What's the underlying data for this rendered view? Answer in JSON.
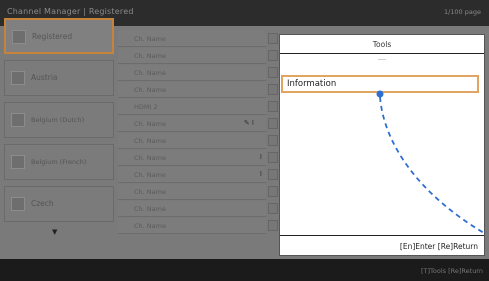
{
  "header": {
    "title": "Channel Manager | Registered",
    "page_indicator": "1/100 page"
  },
  "countries": [
    {
      "label": "Registered",
      "selected": true
    },
    {
      "label": "Austria"
    },
    {
      "label": "Belgium (Dutch)"
    },
    {
      "label": "Belgium (French)"
    },
    {
      "label": "Czech"
    }
  ],
  "scroll_down_glyph": "▼",
  "channels": [
    {
      "label": "Ch. Name"
    },
    {
      "label": "Ch. Name"
    },
    {
      "label": "Ch. Name"
    },
    {
      "label": "Ch. Name"
    },
    {
      "label": "HDMI 2"
    },
    {
      "label": "Ch. Name",
      "icons": "✎ I"
    },
    {
      "label": "Ch. Name"
    },
    {
      "label": "Ch. Name",
      "icons": "I"
    },
    {
      "label": "Ch. Name",
      "icons": "I"
    },
    {
      "label": "Ch. Name"
    },
    {
      "label": "Ch. Name"
    },
    {
      "label": "Ch. Name"
    }
  ],
  "tools_popup": {
    "title": "Tools",
    "highlighted_item": "Information",
    "footer": "[En]Enter  [Re]Return",
    "annotation_color": "#2f6fd0"
  },
  "footer": {
    "hints": "[T]Tools  [Re]Return"
  },
  "colors": {
    "selection_border": "#c8833a",
    "highlight_border": "#e0a560"
  }
}
